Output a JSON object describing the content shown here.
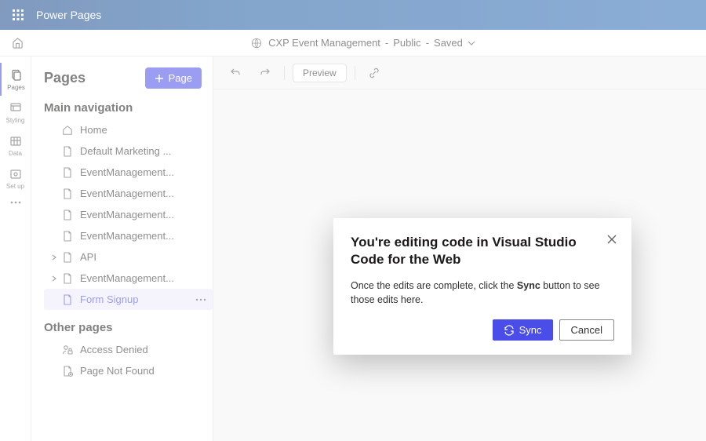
{
  "topbar": {
    "brand": "Power Pages"
  },
  "breadcrumb": {
    "site_name": "CXP Event Management",
    "visibility": "Public",
    "status": "Saved"
  },
  "rail": {
    "items": [
      {
        "id": "pages",
        "label": "Pages",
        "active": true
      },
      {
        "id": "styling",
        "label": "Styling",
        "active": false
      },
      {
        "id": "data",
        "label": "Data",
        "active": false
      },
      {
        "id": "setup",
        "label": "Set up",
        "active": false
      },
      {
        "id": "more",
        "label": "",
        "active": false
      }
    ]
  },
  "sidebar": {
    "title": "Pages",
    "add_page_label": "Page",
    "section_main": "Main navigation",
    "section_other": "Other pages",
    "main_items": [
      {
        "label": "Home",
        "icon": "home",
        "expandable": false,
        "selected": false
      },
      {
        "label": "Default Marketing ...",
        "icon": "doc",
        "expandable": false,
        "selected": false
      },
      {
        "label": "EventManagement...",
        "icon": "doc",
        "expandable": false,
        "selected": false
      },
      {
        "label": "EventManagement...",
        "icon": "doc",
        "expandable": false,
        "selected": false
      },
      {
        "label": "EventManagement...",
        "icon": "doc",
        "expandable": false,
        "selected": false
      },
      {
        "label": "EventManagement...",
        "icon": "doc",
        "expandable": false,
        "selected": false
      },
      {
        "label": "API",
        "icon": "doc",
        "expandable": true,
        "selected": false
      },
      {
        "label": "EventManagement...",
        "icon": "doc",
        "expandable": true,
        "selected": false
      },
      {
        "label": "Form Signup",
        "icon": "doc",
        "expandable": false,
        "selected": true
      }
    ],
    "other_items": [
      {
        "label": "Access Denied",
        "icon": "person-lock"
      },
      {
        "label": "Page Not Found",
        "icon": "doc-missing"
      }
    ]
  },
  "toolbar": {
    "preview_label": "Preview"
  },
  "dialog": {
    "title": "You're editing code in Visual Studio Code for the Web",
    "body_before": "Once the edits are complete, click the ",
    "body_bold": "Sync",
    "body_after": " button to see those edits here.",
    "sync_label": "Sync",
    "cancel_label": "Cancel"
  }
}
